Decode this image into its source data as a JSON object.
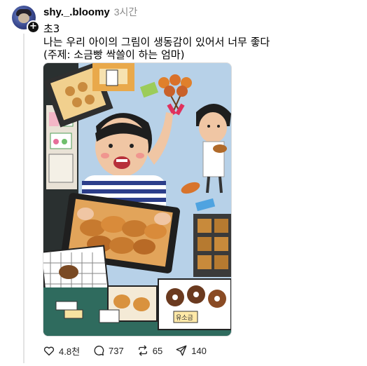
{
  "post": {
    "username": "shy._.bloomy",
    "time": "3시간",
    "text_line1": "초3",
    "text_line2": "나는 우리 아이의 그림이 생동감이 있어서 너무 좋다",
    "text_line3": "(주제: 소금빵 싹쓸이 하는 엄마)"
  },
  "image": {
    "alt_icon": "child-drawing-image",
    "labels": [
      "유소금"
    ]
  },
  "actions": {
    "like_count": "4.8천",
    "comment_count": "737",
    "repost_count": "65",
    "share_count": "140"
  },
  "colors": {
    "text": "#000000",
    "muted": "#8a8a8a",
    "thread_line": "#e3e3e3"
  }
}
